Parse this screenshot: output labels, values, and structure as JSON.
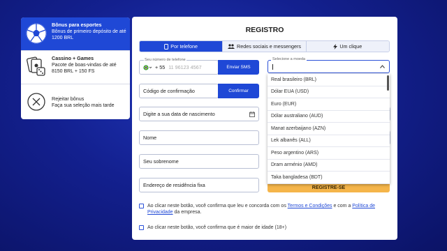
{
  "bonuses": [
    {
      "title": "Bônus para esportes",
      "desc": "Bônus de primeiro depósito de até 1200 BRL",
      "icon": "soccer-ball-icon"
    },
    {
      "title": "Cassino + Games",
      "desc": "Pacote de boas-vindas de até 8150 BRL + 150 FS",
      "icon": "casino-cards-dice-icon"
    },
    {
      "title": "Rejeitar bônus",
      "desc": "Faça sua seleção mais tarde",
      "icon": "reject-x-icon"
    }
  ],
  "form": {
    "title": "REGISTRO",
    "tabs": [
      {
        "label": "Por telefone",
        "icon": "phone-icon"
      },
      {
        "label": "Redes sociais e messengers",
        "icon": "users-icon"
      },
      {
        "label": "Um clique",
        "icon": "lightning-icon"
      }
    ],
    "phone_label": "Seu número de telefone",
    "phone_code": "+ 55",
    "phone_placeholder": "11 96123 4567",
    "send_sms": "Enviar SMS",
    "code_placeholder": "Código de confirmação",
    "confirm": "Confirmar",
    "birthdate": "Digite a sua data de nascimento",
    "name": "Nome",
    "surname": "Seu sobrenome",
    "address": "Endereço de residência fixa",
    "currency_label": "Selecione a moeda",
    "currencies": [
      "Real brasileiro (BRL)",
      "Dólar EUA (USD)",
      "Euro (EUR)",
      "Dólar australiano (AUD)",
      "Manat azerbaijano (AZN)",
      "Lek albanês (ALL)",
      "Peso argentino (ARS)",
      "Dram arménio (AMD)",
      "Taka bangladesa (BDT)"
    ],
    "submit": "REGISTRE-SE",
    "terms_pre": "Ao clicar neste botão, você confirma que leu e concorda com os",
    "terms_link": "Termos e Condições",
    "terms_mid": "e com a",
    "privacy_link_1": "Política de",
    "privacy_link_2": "Privacidade",
    "terms_post": "da empresa.",
    "age_text": "Ao clicar neste botão, você confirma que é maior de idade (18+)"
  },
  "colors": {
    "accent": "#1f48d6",
    "submit": "#f5b54a",
    "background": "#13208f"
  }
}
